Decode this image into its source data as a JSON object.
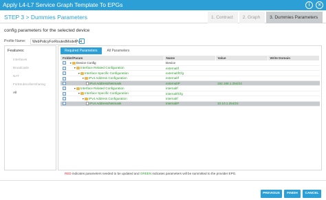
{
  "window": {
    "title": "Apply L4-L7 Service Graph Template To EPGs"
  },
  "stepbar": {
    "current": "STEP 3 > Dummies Parameters",
    "steps": [
      "1. Contract",
      "2. Graph",
      "3. Dummies Parameters"
    ]
  },
  "description": "config parameters for the selected device",
  "profile": {
    "label": "Profile Name:",
    "value": "WebPolicyForRoutedModelPv4"
  },
  "features": {
    "title": "Features:",
    "items": [
      "Interfaces",
      "Broadcasts",
      "NAT",
      "FortiSubscriberSharing",
      "All"
    ],
    "active_index": 4
  },
  "tabs": [
    "Required Parameters",
    "All Parameters"
  ],
  "table": {
    "headers": [
      "Folder/Param",
      "Name",
      "Value",
      "Write Domain"
    ],
    "rows": [
      {
        "indent": 0,
        "kind": "folder",
        "label": "Device Config",
        "name": "Device",
        "value": "",
        "green": false,
        "highlight": false
      },
      {
        "indent": 1,
        "kind": "folder",
        "label": "Interface Related Configuration",
        "name": "externalIf",
        "value": "",
        "green": true,
        "highlight": false
      },
      {
        "indent": 2,
        "kind": "folder",
        "label": "Interface Specific Configuration",
        "name": "externalIfCfg",
        "value": "",
        "green": true,
        "highlight": false
      },
      {
        "indent": 3,
        "kind": "folder",
        "label": "IPv4 Address Configuration",
        "name": "externalIf",
        "value": "",
        "green": true,
        "highlight": false
      },
      {
        "indent": 4,
        "kind": "param",
        "label": "IPv4 Address/Netmask",
        "name": "externalIP",
        "value": "192.168.1.254/24",
        "green": true,
        "highlight": true
      },
      {
        "indent": 1,
        "kind": "folder",
        "label": "Interface Related Configuration",
        "name": "internalIf",
        "value": "",
        "green": true,
        "highlight": false
      },
      {
        "indent": 2,
        "kind": "folder",
        "label": "Interface Specific Configuration",
        "name": "internalIfCfg",
        "value": "",
        "green": true,
        "highlight": false
      },
      {
        "indent": 3,
        "kind": "folder",
        "label": "IPv4 Address Configuration",
        "name": "internalIf",
        "value": "",
        "green": true,
        "highlight": false
      },
      {
        "indent": 4,
        "kind": "param",
        "label": "IPv4 Address/Netmask",
        "name": "internalIP",
        "value": "10.10.1.254/24",
        "green": true,
        "highlight": true
      }
    ]
  },
  "legend": {
    "red_word": "RED",
    "mid_text": " indicates parameters needed to be updated and ",
    "green_word": "GREEN",
    "end_text": " indicates parameters will be summitted to the provider EPG."
  },
  "buttons": {
    "previous": "PREVIOUS",
    "finish": "FINISH",
    "cancel": "CANCEL"
  },
  "colors": {
    "accent": "#2b9fd6",
    "green": "#2a9a2a",
    "red": "#d9232a"
  }
}
